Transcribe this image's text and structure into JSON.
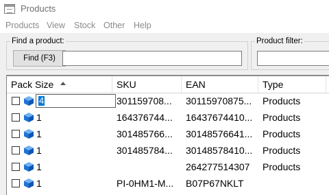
{
  "window": {
    "title": "Products"
  },
  "menu": [
    "Products",
    "View",
    "Stock",
    "Other",
    "Help"
  ],
  "find_group": {
    "label": "Find a product:",
    "button_label": "Find (F3)",
    "input_value": ""
  },
  "filter_group": {
    "label": "Product filter:",
    "input_value": ""
  },
  "table": {
    "columns": [
      "Pack Size",
      "SKU",
      "EAN",
      "Type"
    ],
    "sort_column": "Pack Size",
    "sort_direction": "ascending",
    "editing_value": "4",
    "rows": [
      {
        "pack_size": "4",
        "sku": "301159708...",
        "ean": "30115970875...",
        "type": "Products",
        "checked": false
      },
      {
        "pack_size": "1",
        "sku": "164376744...",
        "ean": "16437674410...",
        "type": "Products",
        "checked": false
      },
      {
        "pack_size": "1",
        "sku": "301485766...",
        "ean": "30148576641...",
        "type": "Products",
        "checked": false
      },
      {
        "pack_size": "1",
        "sku": "301485784...",
        "ean": "30148578410...",
        "type": "Products",
        "checked": false
      },
      {
        "pack_size": "1",
        "sku": "",
        "ean": "264277514307",
        "type": "Products",
        "checked": false
      },
      {
        "pack_size": "1",
        "sku": "PI-0HM1-M...",
        "ean": "B07P67NKLT",
        "type": "",
        "checked": false
      }
    ]
  },
  "colors": {
    "selection": "#0078d7",
    "cube": "#1f73d6"
  },
  "icons": {
    "window": "window-icon",
    "row": "product-cube-icon",
    "sort": "sort-ascending-icon"
  }
}
